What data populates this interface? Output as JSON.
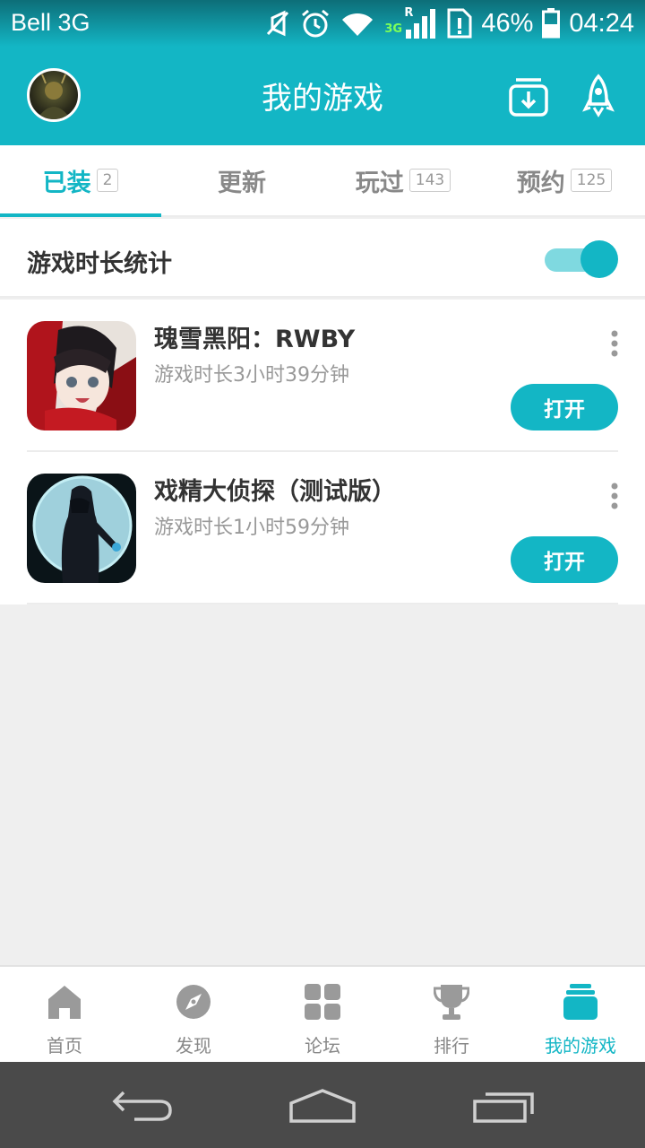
{
  "status_bar": {
    "carrier": "Bell 3G",
    "network": "3G",
    "roaming": "R",
    "battery": "46%",
    "time": "04:24",
    "icons": [
      "mute-icon",
      "alarm-icon",
      "wifi-icon",
      "signal-icon",
      "sim-alert-icon",
      "battery-icon"
    ]
  },
  "header": {
    "title": "我的游戏",
    "icons": [
      "avatar",
      "download-manager-icon",
      "rocket-icon"
    ]
  },
  "tabs": [
    {
      "label": "已装",
      "count": "2",
      "active": true
    },
    {
      "label": "更新",
      "count": ""
    },
    {
      "label": "玩过",
      "count": "143"
    },
    {
      "label": "预约",
      "count": "125"
    }
  ],
  "stats_toggle": {
    "label": "游戏时长统计",
    "on": true
  },
  "games": [
    {
      "name": "瑰雪黑阳：RWBY",
      "playtime": "游戏时长3小时39分钟",
      "action": "打开"
    },
    {
      "name": "戏精大侦探（测试版）",
      "playtime": "游戏时长1小时59分钟",
      "action": "打开"
    }
  ],
  "bottom_nav": [
    {
      "label": "首页",
      "icon": "home-icon"
    },
    {
      "label": "发现",
      "icon": "compass-icon"
    },
    {
      "label": "论坛",
      "icon": "grid-icon"
    },
    {
      "label": "排行",
      "icon": "trophy-icon"
    },
    {
      "label": "我的游戏",
      "icon": "my-games-icon",
      "active": true
    }
  ],
  "colors": {
    "accent": "#13b6c5",
    "background": "#efefef",
    "system_nav": "#4a4a4a"
  }
}
